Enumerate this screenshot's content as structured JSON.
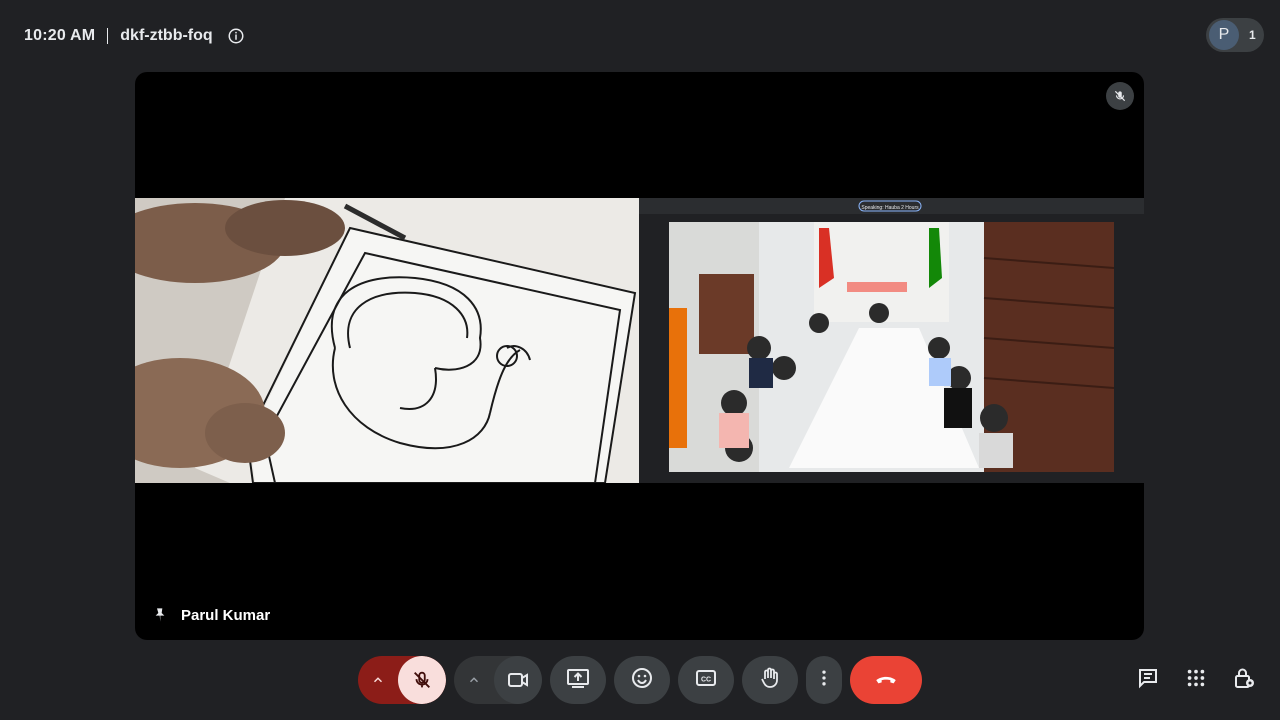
{
  "meeting": {
    "time": "10:20 AM",
    "code": "dkf-ztbb-foq"
  },
  "participants": {
    "avatar_initial": "P",
    "count": "1"
  },
  "presenter": {
    "name": "Parul Kumar"
  },
  "shared_screen": {
    "left_content": "hand drawing peacock in a bordered frame",
    "right_content": "workshop room with participants around a table",
    "right_top_pill": "Speaking: Hauba 2 Hours"
  },
  "controls": {
    "mic_state": "muted",
    "camera_state": "off",
    "icons": [
      "chevron-up-icon",
      "mic-off-icon",
      "chevron-up-icon",
      "videocam-icon",
      "present-screen-icon",
      "emoji-icon",
      "captions-icon",
      "raise-hand-icon",
      "more-vert-icon",
      "call-end-icon",
      "chat-icon",
      "activities-icon",
      "host-controls-icon"
    ]
  },
  "colors": {
    "hangup": "#ea4335",
    "mic_muted_bg": "#f9dedc",
    "mic_group": "#8c1d18",
    "background": "#202124"
  }
}
